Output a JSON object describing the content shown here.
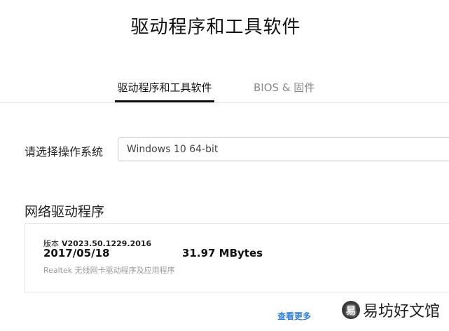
{
  "page": {
    "title": "驱动程序和工具软件"
  },
  "tabs": [
    {
      "label": "驱动程序和工具软件",
      "active": true
    },
    {
      "label": "BIOS & 固件",
      "active": false
    }
  ],
  "os_selector": {
    "label": "请选择操作系统",
    "value": "Windows 10 64-bit"
  },
  "section": {
    "title": "网络驱动程序"
  },
  "driver": {
    "version_prefix": "版本",
    "version": "V2023.50.1229.2016",
    "date": "2017/05/18",
    "size": "31.97 MBytes",
    "description": "Realtek 无线网卡驱动程序及应用程序"
  },
  "view_more": {
    "label": "查看更多",
    "color": "#2f7fd8"
  },
  "watermark": {
    "text": "易坊好文馆"
  }
}
